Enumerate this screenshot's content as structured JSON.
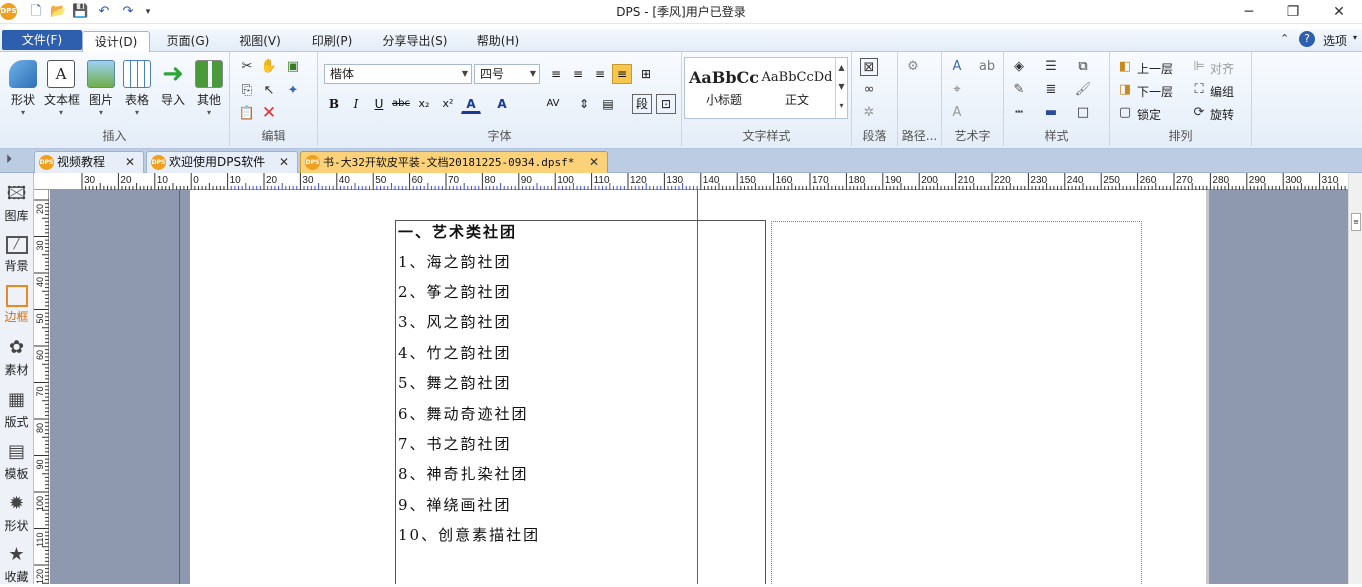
{
  "app": {
    "title": "DPS - [季风]用户已登录"
  },
  "menu": {
    "file": "文件(F)",
    "tabs": [
      "设计(D)",
      "页面(G)",
      "视图(V)",
      "印刷(P)",
      "分享导出(S)",
      "帮助(H)"
    ],
    "options": "选项"
  },
  "ribbon": {
    "insert": {
      "label": "插入",
      "buttons": [
        "形状",
        "文本框",
        "图片",
        "表格",
        "导入",
        "其他"
      ]
    },
    "edit": {
      "label": "编辑"
    },
    "font": {
      "label": "字体",
      "family": "楷体",
      "size": "四号"
    },
    "textstyle": {
      "label": "文字样式",
      "items": [
        {
          "sample": "AaBbCc",
          "name": "小标题"
        },
        {
          "sample": "AaBbCcDd",
          "name": "正文"
        }
      ]
    },
    "paragraph": {
      "label": "段落"
    },
    "path": {
      "label": "路径..."
    },
    "arttext": {
      "label": "艺术字"
    },
    "style": {
      "label": "样式"
    },
    "arrange": {
      "label": "排列",
      "up": "上一层",
      "down": "下一层",
      "lock": "锁定",
      "align": "对齐",
      "group": "编组",
      "rotate": "旋转"
    }
  },
  "doc_tabs": [
    {
      "label": "视频教程",
      "icon": "DPS"
    },
    {
      "label": "欢迎使用DPS软件",
      "icon": "DPS"
    },
    {
      "label": "书-大32开软皮平装-文档20181225-0934.dpsf*",
      "icon": "DPS"
    }
  ],
  "left_panel": [
    "图库",
    "背景",
    "边框",
    "素材",
    "版式",
    "模板",
    "形状",
    "收藏"
  ],
  "ruler": {
    "h_labels": [
      "30",
      "20",
      "10",
      "0",
      "10",
      "20",
      "30",
      "40",
      "50",
      "60",
      "70",
      "80",
      "90",
      "100",
      "110",
      "120",
      "130",
      "140",
      "150",
      "160",
      "170",
      "180",
      "190",
      "200",
      "210",
      "220",
      "230",
      "240",
      "250",
      "260",
      "270",
      "280",
      "290",
      "300",
      "310"
    ],
    "v_labels": [
      "20",
      "30",
      "40",
      "50",
      "60",
      "70",
      "80",
      "90",
      "100",
      "110",
      "120"
    ]
  },
  "document": {
    "lines": [
      "一、艺术类社团",
      "1、海之韵社团",
      "2、筝之韵社团",
      "3、风之韵社团",
      "4、竹之韵社团",
      "5、舞之韵社团",
      "6、舞动奇迹社团",
      "7、书之韵社团",
      "8、神奇扎染社团",
      "9、禅绕画社团",
      "10、创意素描社团"
    ]
  },
  "colors": {
    "accent": "#2e5fae",
    "active_tab": "#fbd27a",
    "canvas": "#8e98ae",
    "margin_line": "#d93030"
  }
}
